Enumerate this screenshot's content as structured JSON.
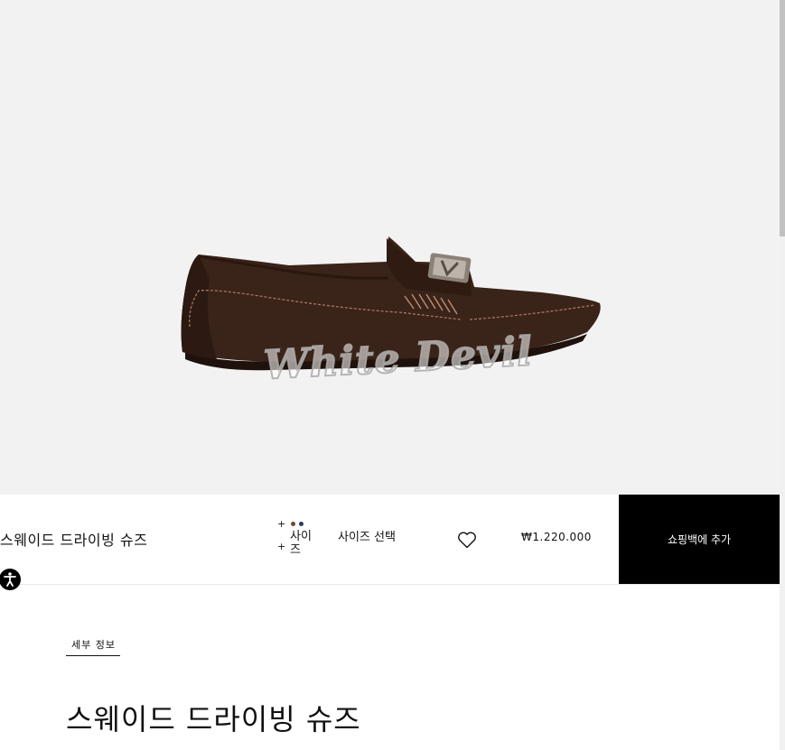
{
  "product": {
    "name": "스웨이드 드라이빙 슈즈",
    "price": "₩1.220.000",
    "watermark": "White Devil"
  },
  "selectors": {
    "color_plus": "+",
    "size_plus": "+",
    "size_short": "사이즈",
    "size_select": "사이즈 선택",
    "color_swatches": [
      "#6e4a3a",
      "#2b3a5e"
    ]
  },
  "actions": {
    "add_to_bag": "쇼핑백에 추가"
  },
  "details": {
    "tab_label": "세부 정보",
    "heading": "스웨이드 드라이빙 슈즈"
  },
  "colors": {
    "shoe": "#3a2318",
    "hero_background": "#f2f2f2",
    "button_background": "#000000"
  },
  "icons": [
    "wishlist-heart-icon",
    "accessibility-icon"
  ]
}
